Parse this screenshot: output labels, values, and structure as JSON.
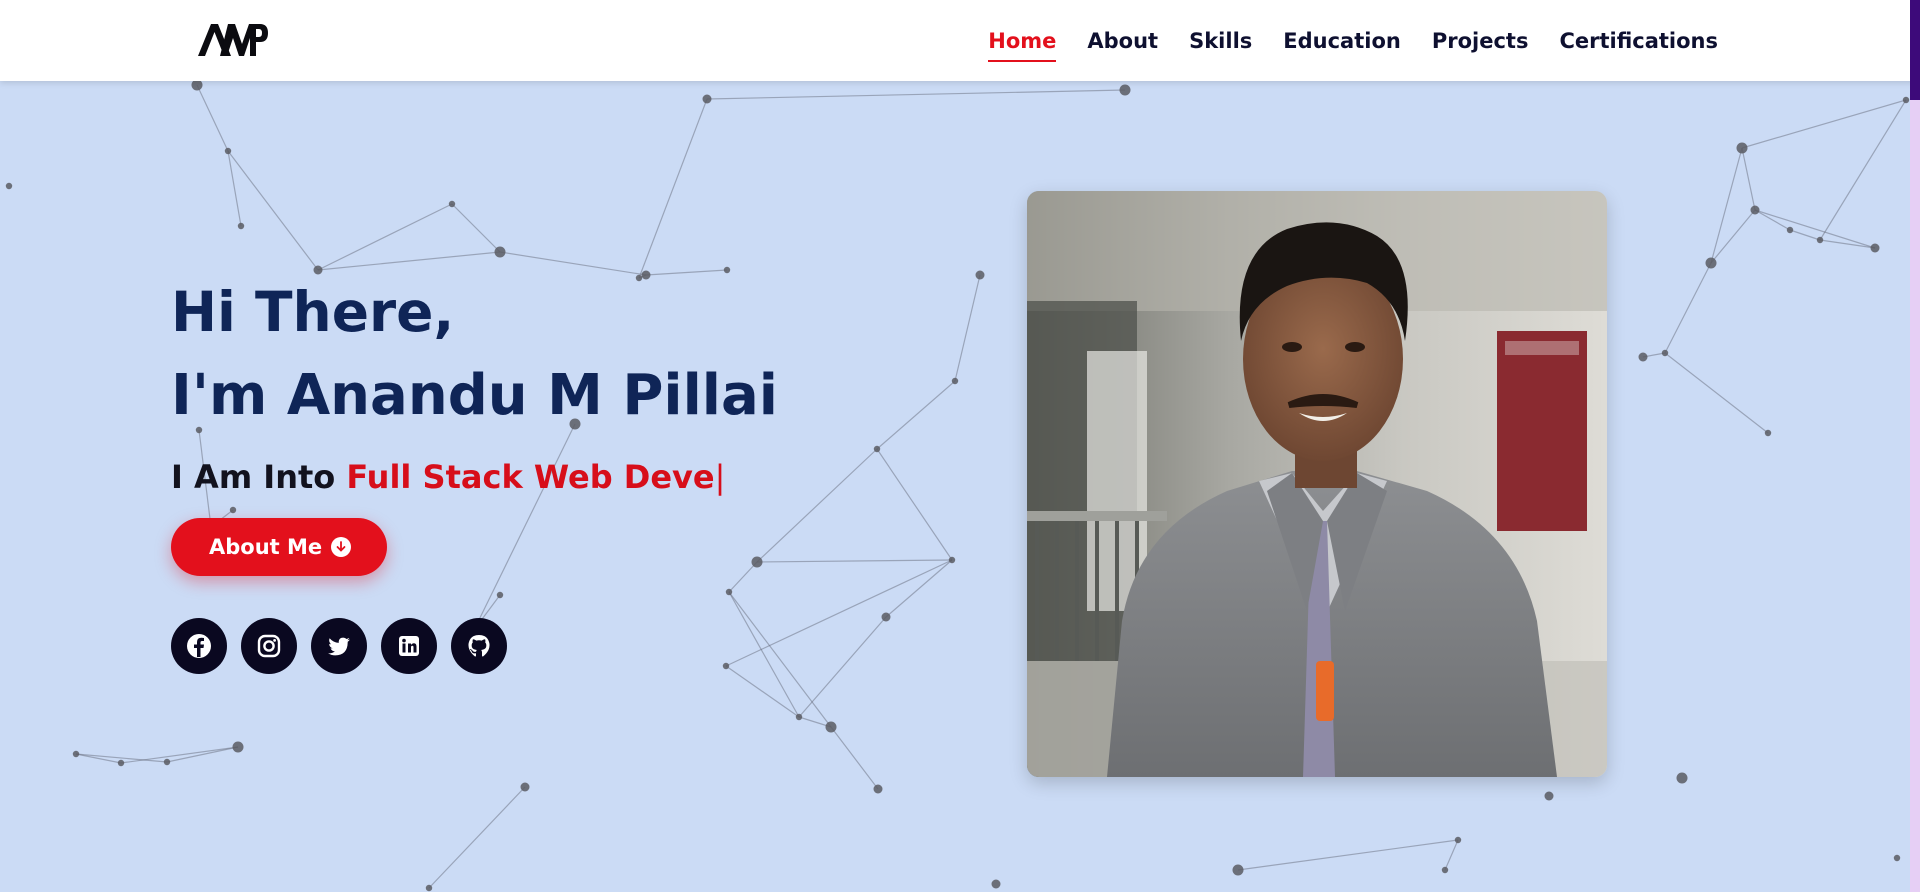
{
  "logo": {
    "text": "AMP"
  },
  "nav": {
    "items": [
      {
        "label": "Home",
        "active": true
      },
      {
        "label": "About",
        "active": false
      },
      {
        "label": "Skills",
        "active": false
      },
      {
        "label": "Education",
        "active": false
      },
      {
        "label": "Projects",
        "active": false
      },
      {
        "label": "Certifications",
        "active": false
      }
    ]
  },
  "hero": {
    "greeting": "Hi There,",
    "name": "I'm Anandu M Pillai",
    "typed_prefix": "I Am Into ",
    "typed_role": "Full Stack Web Deve",
    "typed_cursor": "|",
    "button_label": "About Me",
    "socials": [
      "facebook-icon",
      "instagram-icon",
      "twitter-icon",
      "linkedin-icon",
      "github-icon"
    ]
  },
  "photo": {
    "alt": "Portrait of Anandu M Pillai"
  },
  "colors": {
    "accent": "#e3101c",
    "heading": "#0f2557",
    "background": "#cbdbf5",
    "social_bg": "#0a0820"
  }
}
